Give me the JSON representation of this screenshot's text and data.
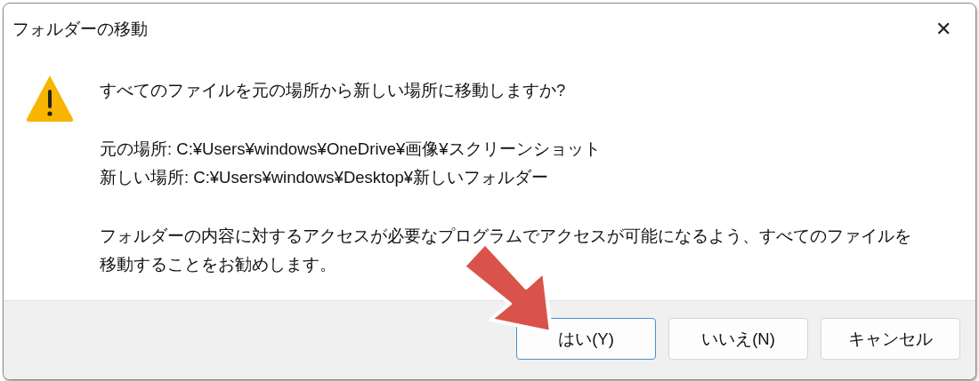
{
  "window": {
    "title": "フォルダーの移動",
    "close": "✕"
  },
  "message": {
    "question": "すべてのファイルを元の場所から新しい場所に移動しますか?",
    "details": [
      "元の場所: C:¥Users¥windows¥OneDrive¥画像¥スクリーンショット",
      "新しい場所: C:¥Users¥windows¥Desktop¥新しいフォルダー"
    ],
    "note": "フォルダーの内容に対するアクセスが必要なプログラムでアクセスが可能になるよう、すべてのファイルを移動することをお勧めします。"
  },
  "buttons": [
    {
      "label": "はい(Y)",
      "selected": true
    },
    {
      "label": "いいえ(N)",
      "selected": false
    },
    {
      "label": "キャンセル",
      "selected": false
    }
  ]
}
